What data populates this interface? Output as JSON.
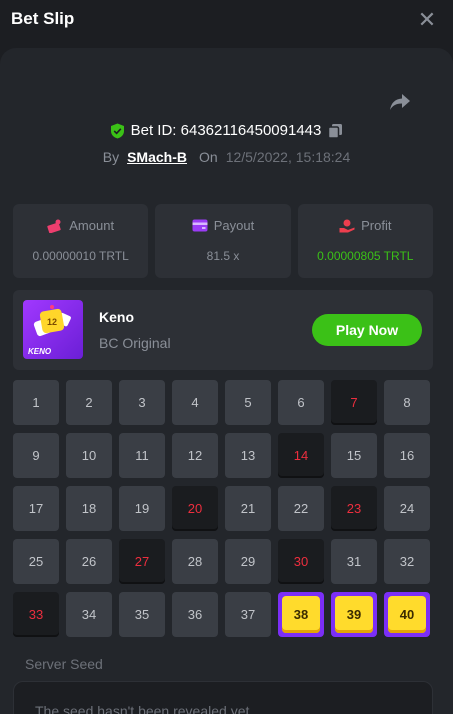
{
  "header": {
    "title": "Bet Slip"
  },
  "bet": {
    "id_label": "Bet ID: 64362116450091443",
    "by_label": "By",
    "user": "SMach-B",
    "on_label": "On",
    "date": "12/5/2022, 15:18:24"
  },
  "stats": {
    "amount": {
      "label": "Amount",
      "value": "0.00000010 TRTL"
    },
    "payout": {
      "label": "Payout",
      "value": "81.5 x"
    },
    "profit": {
      "label": "Profit",
      "value": "0.00000805 TRTL"
    }
  },
  "game": {
    "name": "Keno",
    "provider": "BC Original",
    "play_label": "Play Now",
    "thumb_text": "KENO",
    "thumb_tile": "12"
  },
  "board": {
    "numbers": [
      "1",
      "2",
      "3",
      "4",
      "5",
      "6",
      "7",
      "8",
      "9",
      "10",
      "11",
      "12",
      "13",
      "14",
      "15",
      "16",
      "17",
      "18",
      "19",
      "20",
      "21",
      "22",
      "23",
      "24",
      "25",
      "26",
      "27",
      "28",
      "29",
      "30",
      "31",
      "32",
      "33",
      "34",
      "35",
      "36",
      "37",
      "38",
      "39",
      "40"
    ],
    "picked": [
      "7",
      "14",
      "20",
      "23",
      "27",
      "30",
      "33"
    ],
    "hits": [
      "38",
      "39",
      "40"
    ]
  },
  "seed": {
    "label": "Server Seed",
    "text": "The seed hasn't been revealed yet"
  },
  "colors": {
    "accent_green": "#3bc117",
    "picked_red": "#ed2e3e",
    "hit_purple": "#7b2ef7",
    "hit_yellow": "#ffdb2c"
  }
}
